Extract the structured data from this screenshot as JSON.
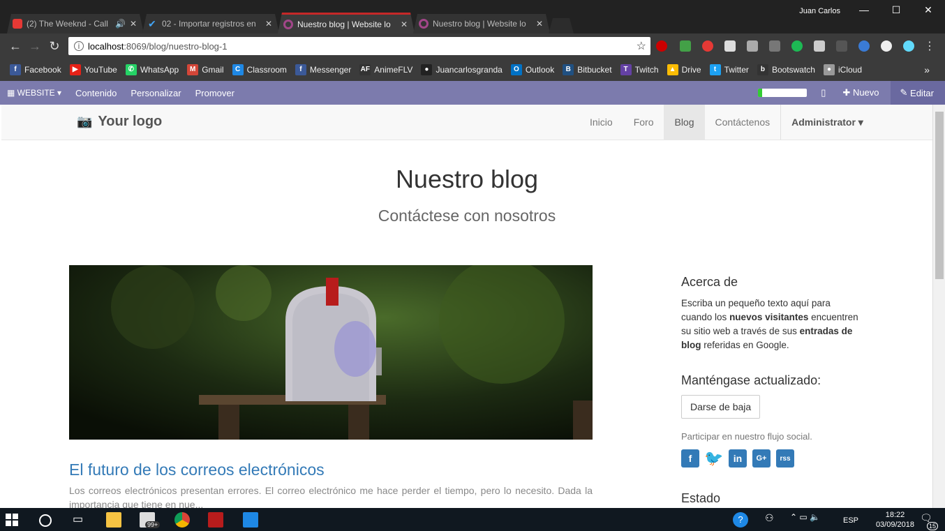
{
  "browser": {
    "user": "Juan Carlos",
    "tabs": [
      {
        "title": "(2) The Weeknd - Call",
        "color": "#e53935"
      },
      {
        "title": "02 - Importar registros en",
        "color": "#42a5f5"
      },
      {
        "title": "Nuestro blog | Website lo",
        "color": "#a24689"
      },
      {
        "title": "Nuestro blog | Website lo",
        "color": "#a24689"
      }
    ],
    "url_host": "localhost",
    "url_rest": ":8069/blog/nuestro-blog-1",
    "bookmarks": [
      {
        "label": "Facebook",
        "color": "#3b5998",
        "icon": "f"
      },
      {
        "label": "YouTube",
        "color": "#e62117",
        "icon": "▶"
      },
      {
        "label": "WhatsApp",
        "color": "#25d366",
        "icon": "✆"
      },
      {
        "label": "Gmail",
        "color": "#d44638",
        "icon": "M"
      },
      {
        "label": "Classroom",
        "color": "#1e88e5",
        "icon": "C"
      },
      {
        "label": "Messenger",
        "color": "#3b5998",
        "icon": "f"
      },
      {
        "label": "AnimeFLV",
        "color": "#333",
        "icon": "AF"
      },
      {
        "label": "Juancarlosgranda",
        "color": "#222",
        "icon": "●"
      },
      {
        "label": "Outlook",
        "color": "#0072c6",
        "icon": "O"
      },
      {
        "label": "Bitbucket",
        "color": "#205081",
        "icon": "B"
      },
      {
        "label": "Twitch",
        "color": "#6441a4",
        "icon": "T"
      },
      {
        "label": "Drive",
        "color": "#fbbc05",
        "icon": "▲"
      },
      {
        "label": "Twitter",
        "color": "#1da1f2",
        "icon": "t"
      },
      {
        "label": "Bootswatch",
        "color": "#333",
        "icon": "b"
      },
      {
        "label": "iCloud",
        "color": "#999",
        "icon": "●"
      }
    ],
    "bookmarks_more": "»"
  },
  "odoo_bar": {
    "website": "WEBSITE",
    "items": [
      "Contenido",
      "Personalizar",
      "Promover"
    ],
    "progress": 0.08,
    "new": "Nuevo",
    "edit": "Editar"
  },
  "site": {
    "logo": "Your logo",
    "nav": [
      "Inicio",
      "Foro",
      "Blog",
      "Contáctenos"
    ],
    "active_nav": "Blog",
    "admin": "Administrator",
    "title": "Nuestro blog",
    "subtitle": "Contáctese con nosotros",
    "post_title": "El futuro de los correos electrónicos",
    "post_teaser": "Los correos electrónicos presentan errores. El correo electrónico me hace perder el tiempo, pero lo necesito. Dada la importancia que tiene en nue...",
    "about_heading": "Acerca de",
    "about_p1": "Escriba un pequeño texto aquí para cuando los ",
    "about_b1": "nuevos visitantes",
    "about_p2": " encuentren su sitio web a través de sus ",
    "about_b2": "entradas de blog",
    "about_p3": " referidas en Google.",
    "updated_heading": "Manténgase actualizado:",
    "unsubscribe": "Darse de baja",
    "social_text": "Participar en nuestro flujo social.",
    "social": [
      "f",
      "t",
      "in",
      "G+",
      "rss"
    ],
    "estado": "Estado"
  },
  "taskbar": {
    "time": "18:22",
    "date": "03/09/2018",
    "lang": "ESP",
    "badge": "99+",
    "notif": "15"
  }
}
